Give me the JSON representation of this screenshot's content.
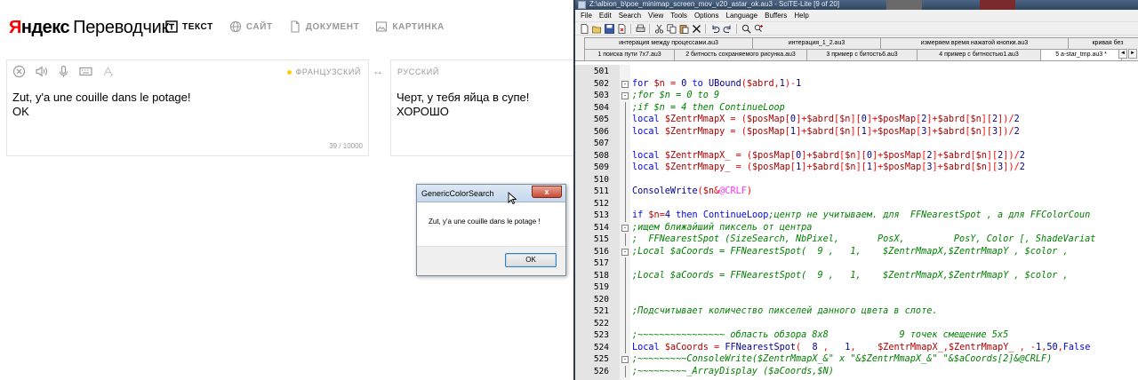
{
  "translator": {
    "logo_brand_first": "Я",
    "logo_brand_rest": "ндекс",
    "logo_product": "Переводчик",
    "tabs": [
      {
        "label": "ТЕКСТ",
        "icon": "text-icon",
        "active": true
      },
      {
        "label": "САЙТ",
        "icon": "globe-icon",
        "active": false
      },
      {
        "label": "ДОКУМЕНТ",
        "icon": "document-icon",
        "active": false
      },
      {
        "label": "КАРТИНКА",
        "icon": "image-icon",
        "active": false
      }
    ],
    "source_lang": "ФРАНЦУЗСКИЙ",
    "target_lang": "РУССКИЙ",
    "swap_glyph": "↔",
    "source_text": "Zut, y'a une couille dans le potage!\nOK",
    "target_text": "Черт, у тебя яйца в супе!\nХОРОШО",
    "counter": "39 / 10000",
    "accent_color": "#ffcc00",
    "brand_color": "#ff0000"
  },
  "message_box": {
    "title": "GenericColorSearch",
    "close_glyph": "x",
    "message": "Zut, y'a une couille dans le potage !",
    "ok_label": "OK"
  },
  "scite": {
    "title": "Z:\\albion_b\\poe_minimap_screen_mov_v20_astar_ok.au3 - SciTE-Lite [9 of 20]",
    "menu": [
      "File",
      "Edit",
      "Search",
      "View",
      "Tools",
      "Options",
      "Language",
      "Buffers",
      "Help"
    ],
    "tabs_row1": [
      "интерация между процессами.au3",
      "интерация_1_2.au3",
      "измеряем время нажатой кнопки.au3",
      "кривая без"
    ],
    "tabs_row2": [
      "1 поиска пути 7x7.au3",
      "2 битность сохраняемого рисунка.au3",
      "3 пример с битость6.au3",
      "4 пример с битностью1.au3",
      "5 a-star_tmp.au3 *"
    ],
    "scroll_left": "◄",
    "scroll_right": "►",
    "lines": [
      {
        "n": "501",
        "fold": "",
        "code": ""
      },
      {
        "n": "502",
        "fold": "-",
        "code": "for $n = 0 to UBound($abrd,1)-1"
      },
      {
        "n": "503",
        "fold": "-",
        "code": ";for $n = 0 to 9"
      },
      {
        "n": "504",
        "fold": "",
        "code": ";if $n = 4 then ContinueLoop"
      },
      {
        "n": "505",
        "fold": "",
        "code": "local $ZentrMmapX = ($posMap[0]+$abrd[$n][0]+$posMap[2]+$abrd[$n][2])/2"
      },
      {
        "n": "506",
        "fold": "",
        "code": "local $ZentrMmapy = ($posMap[1]+$abrd[$n][1]+$posMap[3]+$abrd[$n][3])/2"
      },
      {
        "n": "507",
        "fold": "",
        "code": ""
      },
      {
        "n": "508",
        "fold": "",
        "code": "local $ZentrMmapX_ = ($posMap[0]+$abrd[$n][0]+$posMap[2]+$abrd[$n][2])/2"
      },
      {
        "n": "509",
        "fold": "",
        "code": "local $ZentrMmapy_ = ($posMap[1]+$abrd[$n][1]+$posMap[3]+$abrd[$n][3])/2"
      },
      {
        "n": "510",
        "fold": "",
        "code": ""
      },
      {
        "n": "511",
        "fold": "",
        "code": "ConsoleWrite($n&@CRLF)"
      },
      {
        "n": "512",
        "fold": "",
        "code": ""
      },
      {
        "n": "513",
        "fold": "",
        "code": "if $n=4 then ContinueLoop;центр не учитываем. для  FFNearestSpot , а для FFColorCoun"
      },
      {
        "n": "514",
        "fold": "-",
        "code": ";ищем ближайший пиксель от центра"
      },
      {
        "n": "515",
        "fold": "",
        "code": ";  FFNearestSpot (SizeSearch, NbPixel,       PosX,         PosY, Color [, ShadeVariat"
      },
      {
        "n": "516",
        "fold": "-",
        "code": ";Local $aCoords = FFNearestSpot(  9 ,   1,    $ZentrMmapX,$ZentrMmapY , $color ,"
      },
      {
        "n": "517",
        "fold": "",
        "code": ""
      },
      {
        "n": "518",
        "fold": "",
        "code": ";Local $aCoords = FFNearestSpot(  9 ,   1,    $ZentrMmapX,$ZentrMmapY , $color ,"
      },
      {
        "n": "519",
        "fold": "",
        "code": ""
      },
      {
        "n": "520",
        "fold": "",
        "code": ""
      },
      {
        "n": "521",
        "fold": "",
        "code": ";Подсчитывает количество пикселей данного цвета в слоте."
      },
      {
        "n": "522",
        "fold": "",
        "code": ""
      },
      {
        "n": "523",
        "fold": "",
        "code": ";~~~~~~~~~~~~~~~~ область обзора 8x8             9 точек смещение 5x5"
      },
      {
        "n": "524",
        "fold": "",
        "code": "Local $aCoords = FFNearestSpot(  8 ,   1,    $ZentrMmapX_,$ZentrMmapY_ , -1,50,False"
      },
      {
        "n": "525",
        "fold": "-",
        "code": ";~~~~~~~~~ConsoleWrite($ZentrMmapX_&\" x \"&$ZentrMmapX_&\" \"&$aCoords[2]&@CRLF)"
      },
      {
        "n": "526",
        "fold": "",
        "code": ";~~~~~~~~~_ArrayDisplay ($aCoords,$N)"
      }
    ]
  }
}
